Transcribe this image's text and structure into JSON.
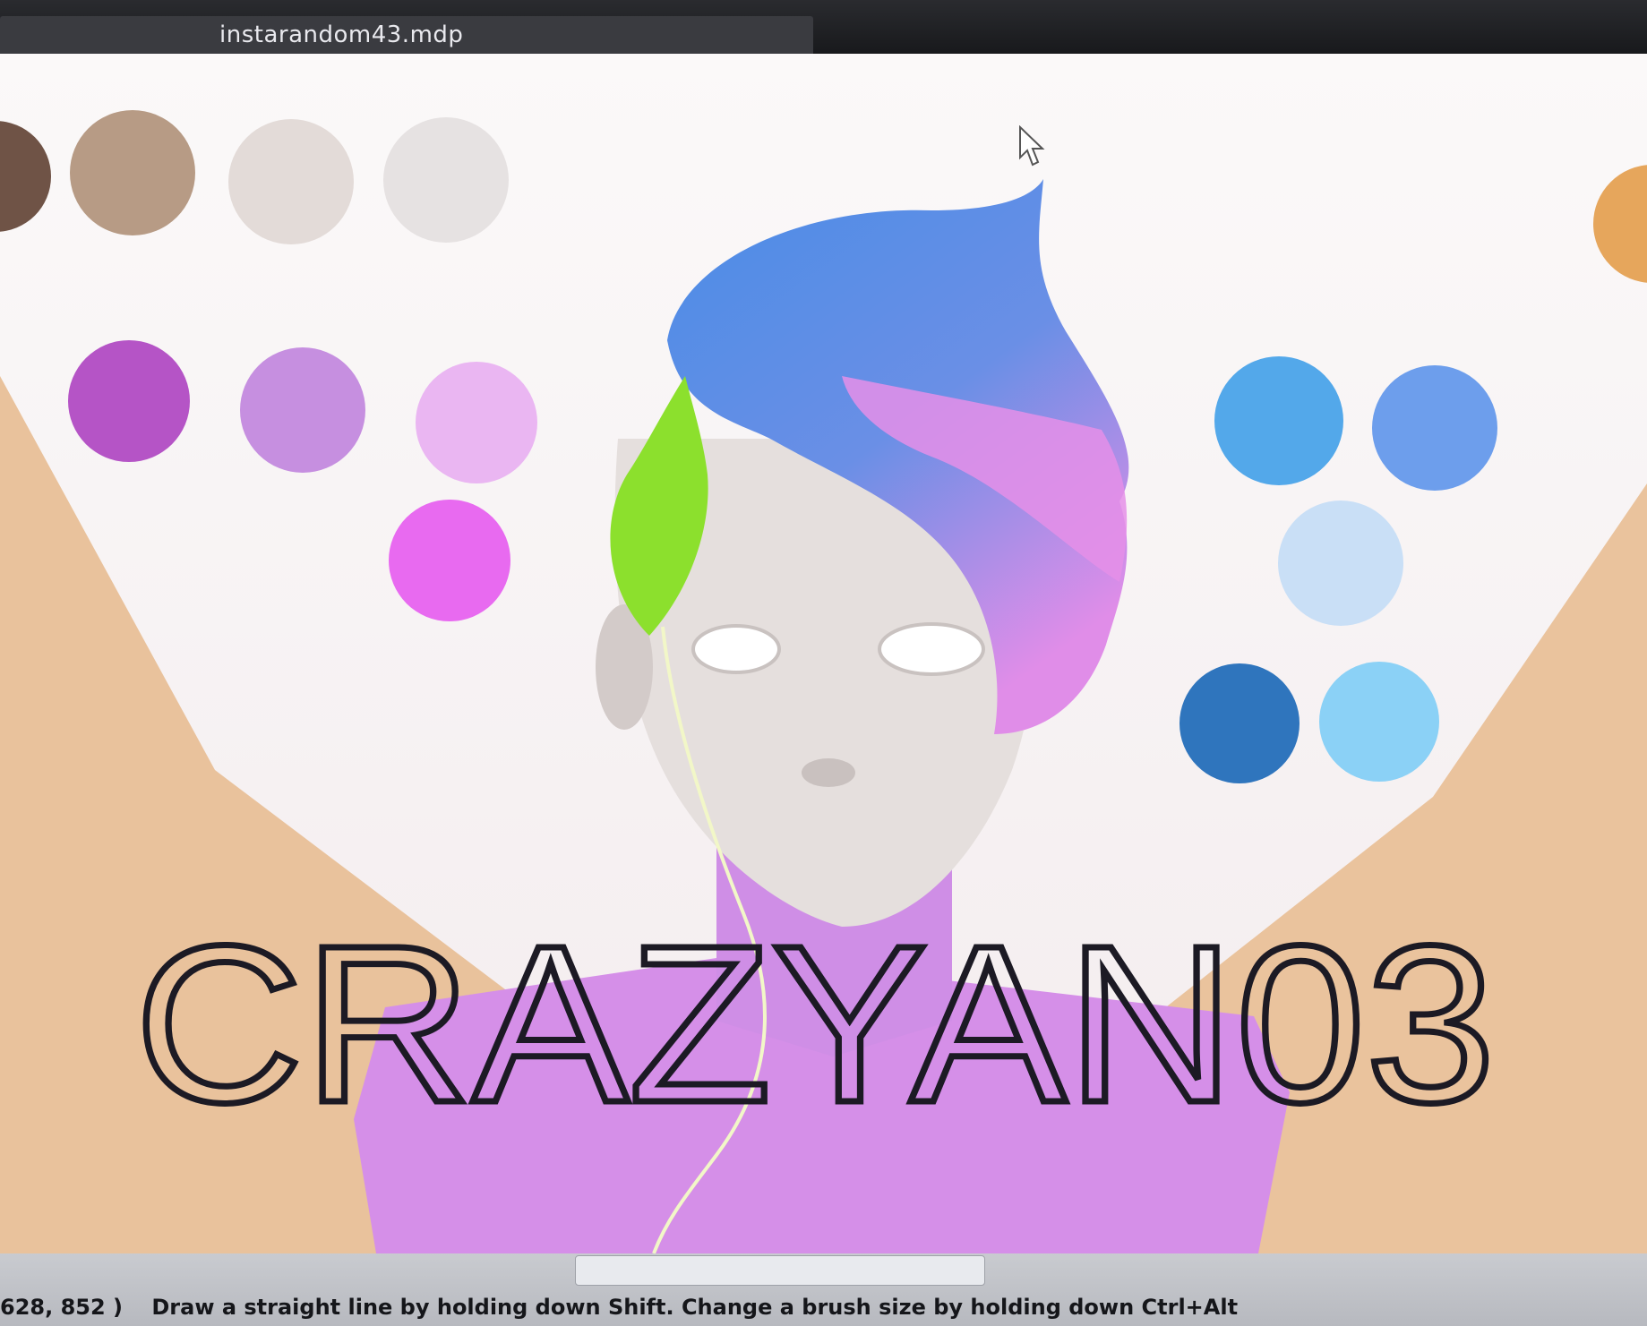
{
  "window": {
    "file_tab": "instarandom43.mdp"
  },
  "canvas": {
    "title_text": "CRAZYAN03",
    "palette_left": [
      "#6f5346",
      "#b79b85",
      "#e3dbd8",
      "#e6e2e2",
      "#b554c6",
      "#c68fe0",
      "#eab6f2",
      "#e86af0"
    ],
    "palette_right": [
      "#e6a65c",
      "#53a8ea",
      "#6d9eec",
      "#c9dff6",
      "#2f75bd",
      "#8bd1f6"
    ],
    "hair_colors": [
      "#4e8de0",
      "#e58fe7"
    ],
    "skin_color": "#e5dfdd",
    "body_color": "#d58fe8",
    "background_color": "#e8c09a"
  },
  "status": {
    "coords": "628, 852 )",
    "hint": "Draw a straight line by holding down Shift. Change a brush size by holding down Ctrl+Alt"
  }
}
